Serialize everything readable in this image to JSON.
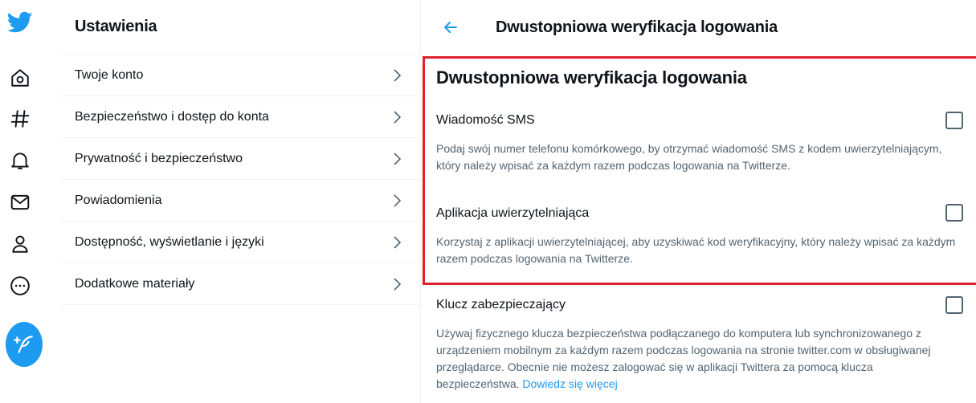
{
  "settings": {
    "title": "Ustawienia",
    "items": [
      {
        "label": "Twoje konto"
      },
      {
        "label": "Bezpieczeństwo i dostęp do konta"
      },
      {
        "label": "Prywatność i bezpieczeństwo"
      },
      {
        "label": "Powiadomienia"
      },
      {
        "label": "Dostępność, wyświetlanie i języki"
      },
      {
        "label": "Dodatkowe materiały"
      }
    ]
  },
  "detail": {
    "header_title": "Dwustopniowa weryfikacja logowania",
    "section_title": "Dwustopniowa weryfikacja logowania",
    "options": [
      {
        "label": "Wiadomość SMS",
        "description": "Podaj swój numer telefonu komórkowego, by otrzymać wiadomość SMS z kodem uwierzytelniającym, który należy wpisać za każdym razem podczas logowania na Twitterze.",
        "checked": false
      },
      {
        "label": "Aplikacja uwierzytelniająca",
        "description": "Korzystaj z aplikacji uwierzytelniającej, aby uzyskiwać kod weryfikacyjny, który należy wpisać za każdym razem podczas logowania na Twitterze.",
        "checked": false
      },
      {
        "label": "Klucz zabezpieczający",
        "description": "Używaj fizycznego klucza bezpieczeństwa podłączanego do komputera lub synchronizowanego z urządzeniem mobilnym za każdym razem podczas logowania na stronie twitter.com w obsługiwanej przeglądarce. Obecnie nie możesz zalogować się w aplikacji Twittera za pomocą klucza bezpieczeństwa.",
        "link": "Dowiedz się więcej",
        "checked": false
      }
    ]
  },
  "nav_icons": [
    "twitter-logo-icon",
    "home-icon",
    "explore-hashtag-icon",
    "notifications-bell-icon",
    "messages-envelope-icon",
    "profile-person-icon",
    "more-options-icon",
    "compose-tweet-icon"
  ],
  "colors": {
    "accent": "#1d9bf0",
    "highlight": "#e0202e",
    "text": "#0f1419",
    "secondary_text": "#536471",
    "divider": "#eff3f4"
  }
}
